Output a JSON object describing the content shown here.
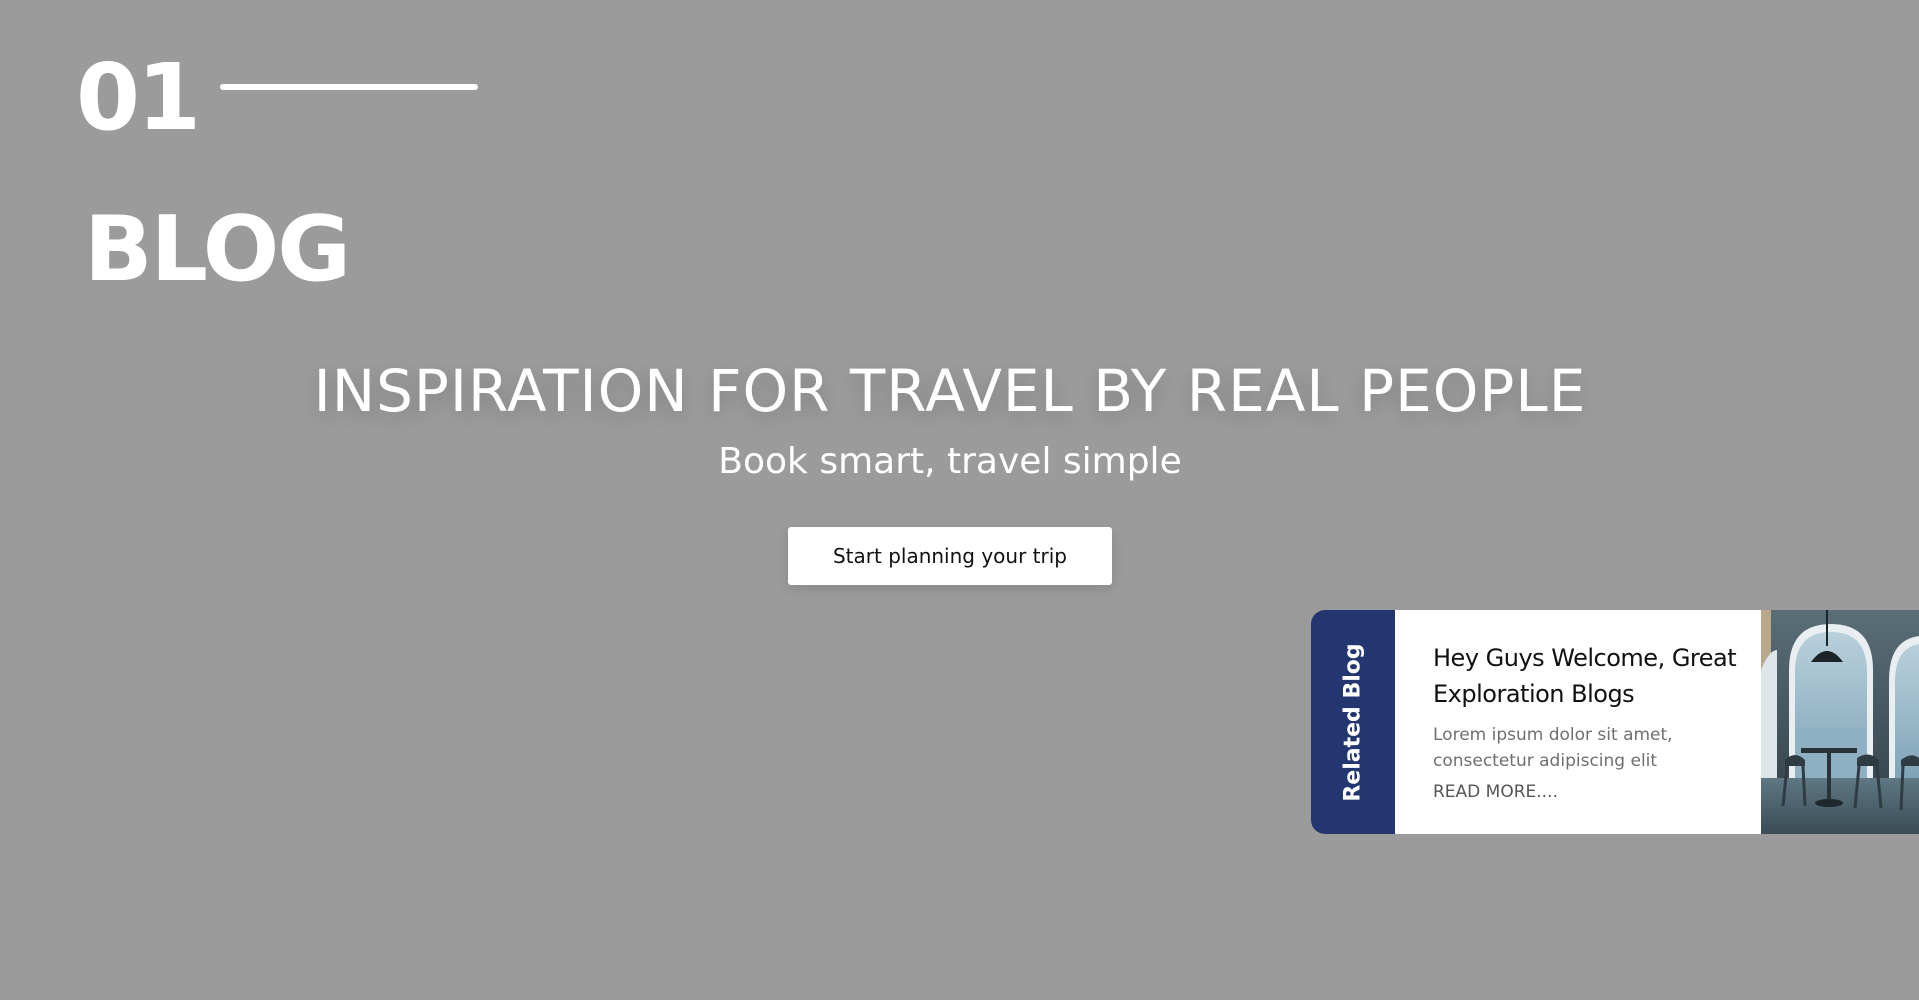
{
  "slide": {
    "number": "01"
  },
  "section": {
    "title": "BLOG"
  },
  "hero": {
    "headline": "INSPIRATION FOR TRAVEL BY REAL PEOPLE",
    "subtitle": "Book smart, travel simple",
    "cta_label": "Start planning your trip"
  },
  "related_blog": {
    "tab_label": "Related Blog",
    "title": "Hey Guys Welcome, Great Exploration Blogs",
    "excerpt": "Lorem ipsum dolor sit amet, consectetur adipiscing elit",
    "read_more": "READ MORE....",
    "image_icon": "cafe-window-photo"
  },
  "colors": {
    "background": "#9b9b9b",
    "tab_background": "#24366f",
    "card_background": "#ffffff",
    "text_light": "#ffffff"
  }
}
